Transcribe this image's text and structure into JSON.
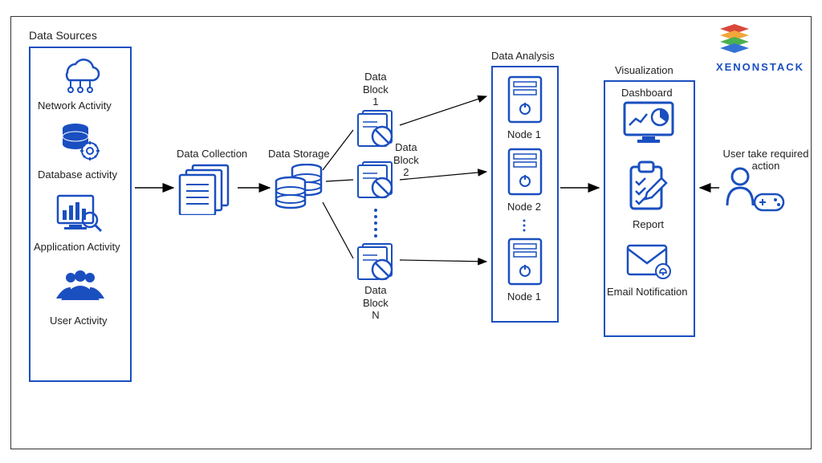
{
  "brand": {
    "name": "XENONSTACK"
  },
  "sections": {
    "dataSources": {
      "title": "Data Sources",
      "items": [
        "Network Activity",
        "Database activity",
        "Application Activity",
        "User Activity"
      ]
    },
    "dataCollection": {
      "title": "Data Collection"
    },
    "dataStorage": {
      "title": "Data Storage"
    },
    "dataBlocks": {
      "block1": "Data\nBlock\n1",
      "block2": "Data\nBlock\n2",
      "blockN": "Data\nBlock\nN"
    },
    "dataAnalysis": {
      "title": "Data Analysis",
      "nodes": [
        "Node 1",
        "Node 2",
        "Node 1"
      ]
    },
    "visualization": {
      "title": "Visualization",
      "items": [
        "Dashboard",
        "Report",
        "Email Notification"
      ]
    },
    "userAction": {
      "title": "User take required action"
    }
  }
}
